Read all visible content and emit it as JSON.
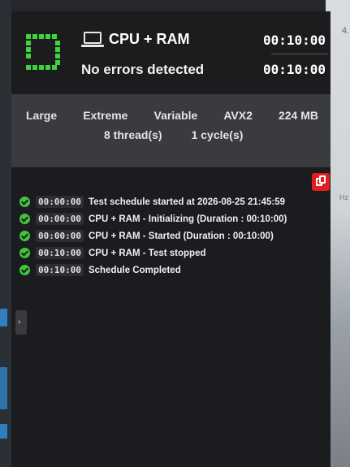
{
  "header": {
    "test_name": "CPU + RAM",
    "status": "No errors detected",
    "elapsed_time": "00:10:00",
    "duration_time": "00:10:00"
  },
  "settings": {
    "row1": [
      "Large",
      "Extreme",
      "Variable",
      "AVX2",
      "224 MB"
    ],
    "row2": [
      "8 thread(s)",
      "1 cycle(s)"
    ]
  },
  "log": [
    {
      "time": "00:00:00",
      "message": "Test schedule started at 2026-08-25 21:45:59"
    },
    {
      "time": "00:00:00",
      "message": "CPU + RAM - Initializing (Duration : 00:10:00)"
    },
    {
      "time": "00:00:00",
      "message": "CPU + RAM - Started (Duration : 00:10:00)"
    },
    {
      "time": "00:10:00",
      "message": "CPU + RAM - Test stopped"
    },
    {
      "time": "00:10:00",
      "message": "Schedule Completed"
    }
  ],
  "background": {
    "right_digit": "4.",
    "right_hz": "Hz"
  },
  "colors": {
    "accent_green": "#3cd63c",
    "copy_red": "#e01e1e",
    "check_green": "#41c33b"
  }
}
